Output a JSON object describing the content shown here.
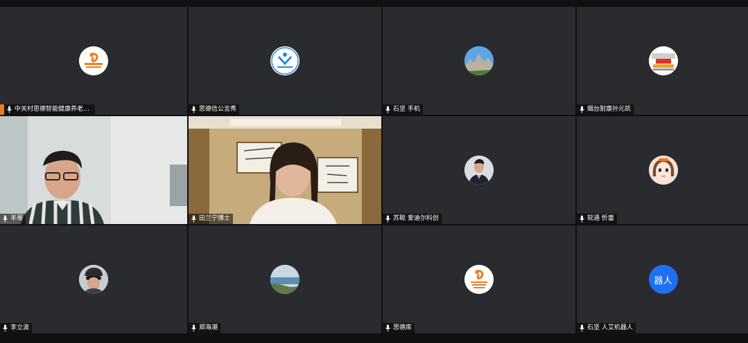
{
  "participants": [
    {
      "name": "中关村思德智能健康养老产...",
      "avatar": "sidel-logo-icon",
      "host": true
    },
    {
      "name": "思德信公言秀",
      "avatar": "association-logo-icon"
    },
    {
      "name": "石坚 手机",
      "avatar": "rock-landscape-icon"
    },
    {
      "name": "烟台耐康孙元凯",
      "avatar": "banner-photo-icon"
    },
    {
      "name": "羊哥",
      "video": true,
      "active": true
    },
    {
      "name": "田兰宁博士",
      "video": true
    },
    {
      "name": "苏聪 爱迪尔科创",
      "avatar": "man-suit-icon"
    },
    {
      "name": "软通 忻蕾",
      "avatar": "cartoon-girl-icon"
    },
    {
      "name": "李立波",
      "avatar": "cyclist-helmet-icon"
    },
    {
      "name": "郑海潮",
      "avatar": "sea-landscape-icon"
    },
    {
      "name": "思德库",
      "avatar": "sidel-logo-icon"
    },
    {
      "name": "石坚 人艾机器人",
      "avatar_text": "器人"
    }
  ],
  "colors": {
    "tile_bg": "#2a2b2e",
    "active_border": "#2fb24c",
    "host_flag": "#f07a1a",
    "text_avatar": "#1f6ff2"
  }
}
